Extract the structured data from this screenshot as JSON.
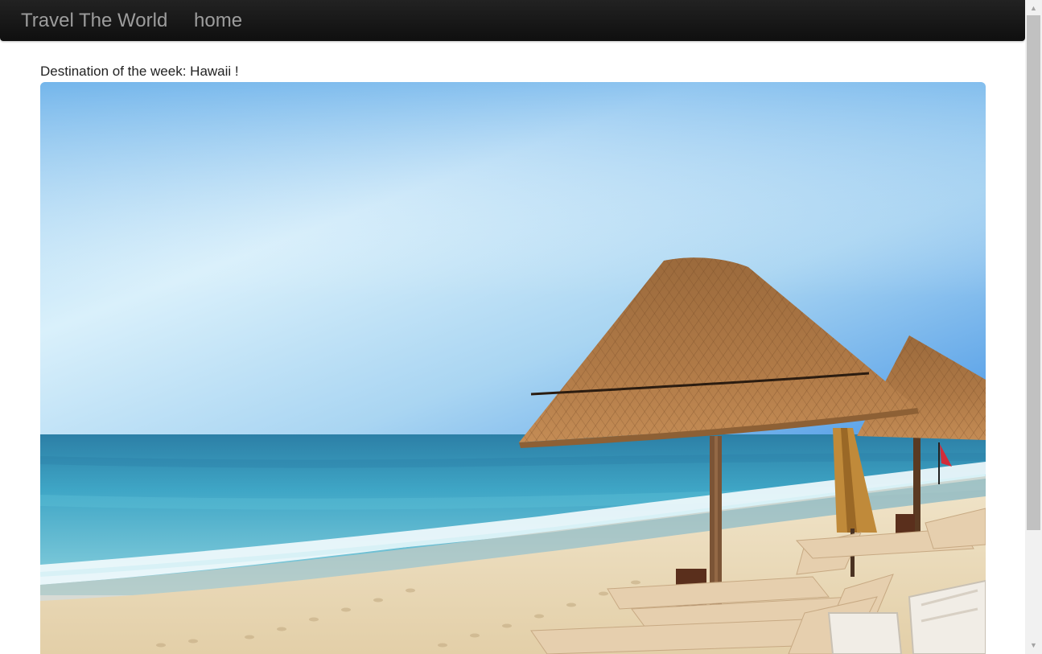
{
  "navbar": {
    "brand": "Travel The World",
    "links": [
      {
        "label": "home"
      }
    ]
  },
  "main": {
    "headline": "Destination of the week: Hawaii !",
    "hero_image": {
      "icon": "beach-photo",
      "alt": "Beach with thatched umbrellas and lounge chairs"
    }
  },
  "scrollbar": {
    "up_icon": "▲",
    "down_icon": "▼"
  },
  "colors": {
    "navbar_bg": "#1b1b1b",
    "nav_text": "#9d9d9d",
    "sky_top": "#4f9ee8",
    "sea": "#49b2cc",
    "sand": "#ead9b9"
  }
}
